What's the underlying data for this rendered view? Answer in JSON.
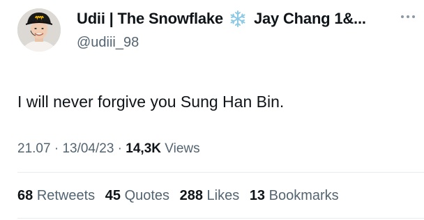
{
  "author": {
    "display_name": "Udii | The Snowflake",
    "name_suffix": "Jay Chang 1&...",
    "name_emoji": "snowflake-icon",
    "handle": "@udiii_98",
    "avatar": "avatar-photo"
  },
  "tweet": {
    "text": "I will never forgive you Sung Han Bin."
  },
  "meta": {
    "time": "21.07",
    "sep1": " · ",
    "date": "13/04/23",
    "sep2": " · ",
    "views_count": "14,3K",
    "views_label": "Views"
  },
  "stats": [
    {
      "count": "68",
      "label": "Retweets"
    },
    {
      "count": "45",
      "label": "Quotes"
    },
    {
      "count": "288",
      "label": "Likes"
    },
    {
      "count": "13",
      "label": "Bookmarks"
    }
  ],
  "icons": {
    "more": "more-icon"
  },
  "colors": {
    "primary_text": "#0f1419",
    "secondary_text": "#536471",
    "divider": "#e6ecf0",
    "snowflake": "#8ecae6"
  }
}
